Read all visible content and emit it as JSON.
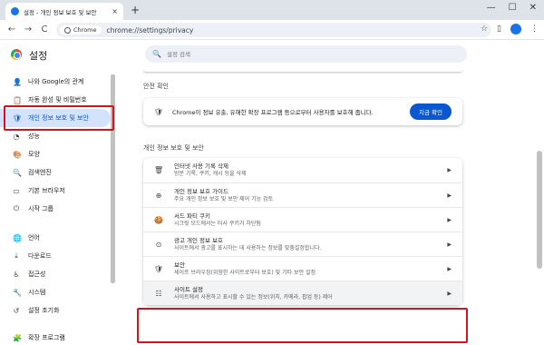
{
  "tab": {
    "title": "설정 - 개인 정보 보호 및 보안",
    "close": "×",
    "new_tab": "+"
  },
  "window_controls": [
    "—",
    "☐",
    "✕"
  ],
  "toolbar": {
    "back": "←",
    "forward": "→",
    "reload": "C",
    "chip_label": "Chrome",
    "url": "chrome://settings/privacy",
    "bookmark": "☆",
    "sidepanel": "▯",
    "menu": "⋮"
  },
  "header": {
    "title": "설정",
    "search_placeholder": "설정 검색"
  },
  "sidebar": {
    "items": [
      {
        "icon": "person-icon",
        "glyph": "👤",
        "label": "나와 Google의 관계"
      },
      {
        "icon": "clipboard-icon",
        "glyph": "📋",
        "label": "자동 완성 및 비밀번호"
      },
      {
        "icon": "shield-icon",
        "glyph": "🛡",
        "label": "개인 정보 보호 및 보안",
        "active": true
      },
      {
        "icon": "speedometer-icon",
        "glyph": "◔",
        "label": "성능"
      },
      {
        "icon": "palette-icon",
        "glyph": "🎨",
        "label": "모양"
      },
      {
        "icon": "search-icon",
        "glyph": "🔍",
        "label": "검색엔진"
      },
      {
        "icon": "browser-icon",
        "glyph": "▭",
        "label": "기본 브라우저"
      },
      {
        "icon": "power-icon",
        "glyph": "⏻",
        "label": "시작 그룹"
      },
      {
        "icon": "globe-icon",
        "glyph": "🌐",
        "label": "언어"
      },
      {
        "icon": "download-icon",
        "glyph": "⤓",
        "label": "다운로드"
      },
      {
        "icon": "accessibility-icon",
        "glyph": "♿",
        "label": "접근성"
      },
      {
        "icon": "wrench-icon",
        "glyph": "🔧",
        "label": "시스템"
      },
      {
        "icon": "history-icon",
        "glyph": "↺",
        "label": "설정 초기화"
      },
      {
        "icon": "puzzle-icon",
        "glyph": "🧩",
        "label": "확장 프로그램"
      }
    ]
  },
  "safety": {
    "section_title": "안전 확인",
    "text": "Chrome이 정보 유출, 유해한 확장 프로그램 등으로부터 사용자를 보호해 줍니다.",
    "button": "지금 확인"
  },
  "privacy": {
    "section_title": "개인 정보 보호 및 보안",
    "rows": [
      {
        "icon": "trash-icon",
        "glyph": "🗑",
        "title": "인터넷 사용 기록 삭제",
        "sub": "방문 기록, 쿠키, 캐시 등을 삭제"
      },
      {
        "icon": "guide-icon",
        "glyph": "⊕",
        "title": "개인 정보 보호 가이드",
        "sub": "주요 개인 정보 보호 및 보안 제어 기능 검토"
      },
      {
        "icon": "cookie-icon",
        "glyph": "🍪",
        "title": "서드 파티 쿠키",
        "sub": "시크릿 모드에서는 타사 쿠키가 차단됨"
      },
      {
        "icon": "ad-privacy-icon",
        "glyph": "⊙",
        "title": "광고 개인 정보 보호",
        "sub": "사이트에서 광고를 표시하는 데 사용하는 정보를 맞춤설정합니다."
      },
      {
        "icon": "security-shield-icon",
        "glyph": "🛡",
        "title": "보안",
        "sub": "세이프 브라우징(위험한 사이트로부터 보호) 및 기타 보안 설정"
      },
      {
        "icon": "tune-icon",
        "glyph": "☷",
        "title": "사이트 설정",
        "sub": "사이트에서 사용하고 표시할 수 있는 정보(위치, 카메라, 팝업 등) 제어",
        "highlighted": true
      }
    ]
  },
  "colors": {
    "accent": "#0b57d0",
    "highlight_box": "#d0151e",
    "active_bg": "#d3e3fd"
  }
}
